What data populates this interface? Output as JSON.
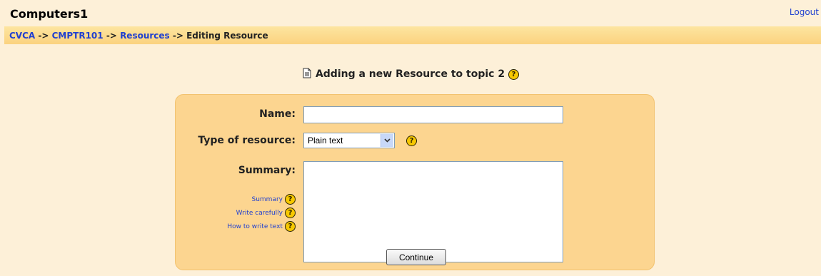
{
  "header": {
    "site_title": "Computers1",
    "logout_label": "Logout"
  },
  "breadcrumb": {
    "items": [
      "CVCA",
      "CMPTR101",
      "Resources"
    ],
    "separator": "->",
    "current": "Editing Resource"
  },
  "page": {
    "heading": "Adding a new Resource to topic 2",
    "heading_icon": "document-icon"
  },
  "form": {
    "name_label": "Name:",
    "name_value": "",
    "type_label": "Type of resource:",
    "type_selected": "Plain text",
    "summary_label": "Summary:",
    "summary_value": "",
    "help_links": [
      "Summary",
      "Write carefully",
      "How to write text"
    ],
    "continue_label": "Continue"
  },
  "colors": {
    "page_bg": "#fdf0d8",
    "navbar_bg": "#fbd27f",
    "form_bg": "#fcd590",
    "link": "#1f3fd0",
    "help_icon": "#f7c800"
  }
}
